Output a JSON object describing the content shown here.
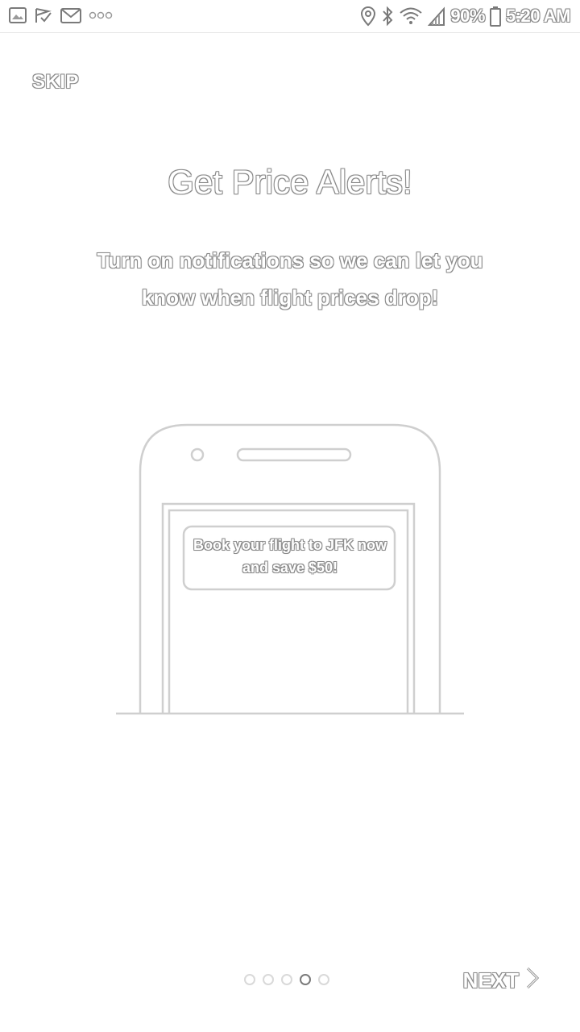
{
  "status_bar": {
    "left_icons": [
      "image-icon",
      "check-flag-icon",
      "mail-icon",
      "more-dots-icon"
    ],
    "right_icons": [
      "location-icon",
      "bluetooth-icon",
      "wifi-icon",
      "signal-icon",
      "battery-icon"
    ],
    "battery": "90%",
    "time": "5:20 AM"
  },
  "onboarding": {
    "skip_label": "SKIP",
    "title": "Get Price Alerts!",
    "subtitle": "Turn on notifications so we can let you know when flight prices drop!",
    "notification_text": "Book your flight to JFK now and save $50!",
    "next_label": "NEXT",
    "page_count": 5,
    "active_page": 4
  },
  "colors": {
    "outline": "#8a8a8a",
    "background": "#ffffff"
  }
}
